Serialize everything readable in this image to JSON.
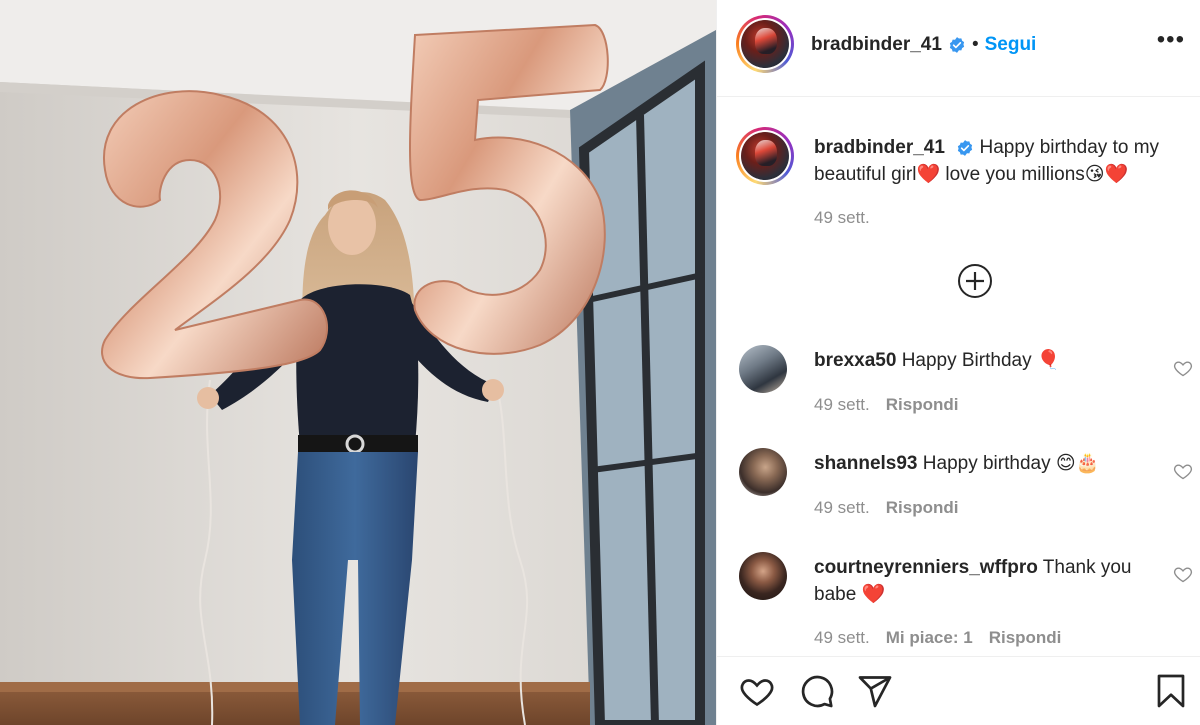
{
  "post": {
    "author": "bradbinder_41",
    "follow_label": "Segui",
    "more_label": "•••",
    "separator": "•",
    "caption_text": "Happy birthday to my beautiful girl❤️ love you millions😘❤️",
    "caption_time": "49 sett."
  },
  "icons": {
    "verified": "verified-badge-icon",
    "more": "more-options-icon",
    "load_more": "plus-circle-icon",
    "like": "heart-icon",
    "comment": "comment-bubble-icon",
    "share": "paper-plane-icon",
    "save": "bookmark-icon"
  },
  "comments": [
    {
      "user": "brexxa50",
      "text": "Happy Birthday 🎈",
      "time": "49 sett.",
      "likes": "",
      "reply": "Rispondi"
    },
    {
      "user": "shannels93",
      "text": "Happy birthday 😊🎂",
      "time": "49 sett.",
      "likes": "",
      "reply": "Rispondi"
    },
    {
      "user": "courtneyrenniers_wffpro",
      "text": "Thank you babe ❤️",
      "time": "49 sett.",
      "likes": "Mi piace: 1",
      "reply": "Rispondi"
    }
  ],
  "colors": {
    "accent": "#0095f6",
    "text": "#262626",
    "muted": "#8e8e8e",
    "border": "#efefef"
  }
}
